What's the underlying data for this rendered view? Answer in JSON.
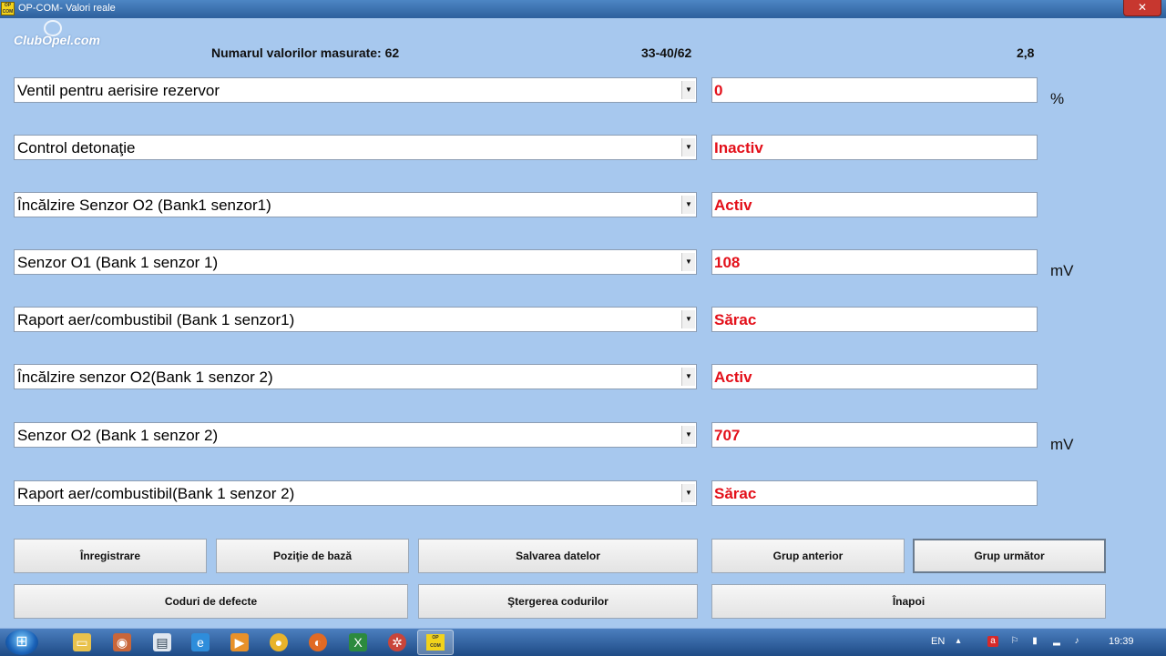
{
  "window": {
    "title": "OP-COM- Valori reale",
    "close_glyph": "✕",
    "app_icon_text": "OP COM"
  },
  "logo": {
    "text": "ClubOpel.com"
  },
  "header": {
    "count_label": "Numarul valorilor masurate: 62",
    "range": "33-40/62",
    "version": "2,8"
  },
  "rows": [
    {
      "label": "Ventil pentru aerisire rezervor",
      "value": "0",
      "unit": "%"
    },
    {
      "label": "Control detonaţie",
      "value": "Inactiv",
      "unit": ""
    },
    {
      "label": "Încălzire Senzor O2 (Bank1 senzor1)",
      "value": "Activ",
      "unit": ""
    },
    {
      "label": "Senzor O1 (Bank 1 senzor 1)",
      "value": "108",
      "unit": "mV"
    },
    {
      "label": "Raport aer/combustibil (Bank 1 senzor1)",
      "value": "Sărac",
      "unit": ""
    },
    {
      "label": "Încălzire senzor O2(Bank 1 senzor 2)",
      "value": "Activ",
      "unit": ""
    },
    {
      "label": "Senzor O2 (Bank 1 senzor 2)",
      "value": "707",
      "unit": "mV"
    },
    {
      "label": "Raport aer/combustibil(Bank 1 senzor 2)",
      "value": "Sărac",
      "unit": ""
    }
  ],
  "dropdown_glyph": "▼",
  "buttons": {
    "record": "Înregistrare",
    "base_position": "Poziţie de bază",
    "save_data": "Salvarea datelor",
    "prev_group": "Grup anterior",
    "next_group": "Grup următor",
    "fault_codes": "Coduri de defecte",
    "clear_codes": "Ştergerea codurilor",
    "back": "Înapoi"
  },
  "taskbar": {
    "start_glyph": "⊞",
    "language": "EN",
    "clock": "19:39",
    "apps": [
      "folder-icon",
      "media-icon",
      "document-icon",
      "internet-explorer-icon",
      "media-player-icon",
      "chrome-icon",
      "firefox-icon",
      "excel-icon",
      "tools-icon"
    ],
    "active_app_text": "OP COM"
  },
  "colors": {
    "background": "#a7c8ee",
    "value_text": "#e3101a",
    "titlebar": "#2d5f9c"
  }
}
